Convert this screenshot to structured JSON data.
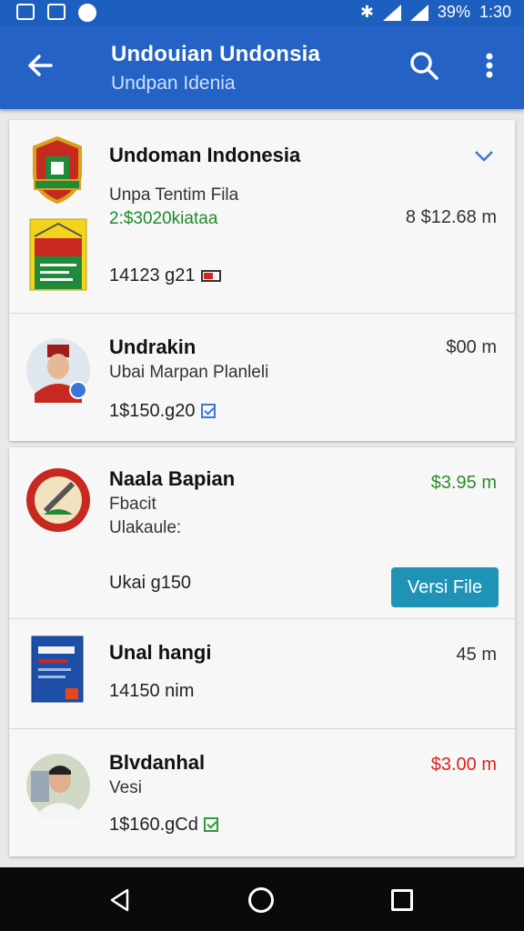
{
  "status_bar": {
    "battery": "39%",
    "time": "1:30"
  },
  "app_bar": {
    "title": "Undouian Undonsia",
    "subtitle": "Undpan Idenia"
  },
  "items": [
    {
      "title": "Undoman Indonesia",
      "subtitle": "Unpa Tentim Fila",
      "code": "2:$3020kiataa",
      "price": "8 $12.68 m",
      "meta": "14123 g21"
    },
    {
      "title": "Undrakin",
      "subtitle": "Ubai Marpan Planleli",
      "price": "$00 m",
      "meta": "1$150.g20"
    },
    {
      "title": "Naala Bapian",
      "subtitle": "Fbacit",
      "subtitle2": "Ulakaule:",
      "price": "$3.95 m",
      "meta": "Ukai g150",
      "button": "Versi File"
    },
    {
      "title": "Unal hangi",
      "price": "45 m",
      "meta": "14150 nim"
    },
    {
      "title": "Blvdanhal",
      "subtitle": "Vesi",
      "price": "$3.00 m",
      "meta": "1$160.gCd"
    }
  ],
  "colors": {
    "primary": "#2462c5",
    "accent": "#1f93b5",
    "positive": "#1f8a2b",
    "negative": "#d8241e"
  }
}
